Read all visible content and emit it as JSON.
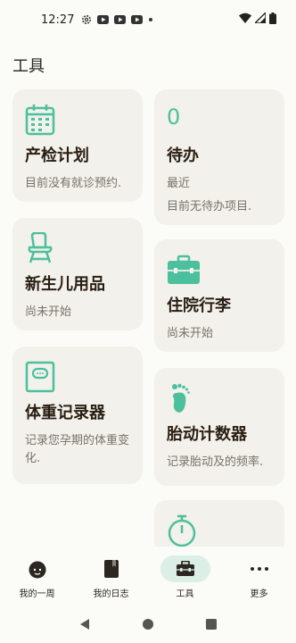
{
  "status_bar": {
    "time": "12:27",
    "icons": [
      "settings-icon",
      "youtube-icon",
      "youtube-icon",
      "youtube-icon",
      "dot-icon"
    ],
    "right_icons": [
      "wifi-icon",
      "signal-icon",
      "battery-icon"
    ]
  },
  "page": {
    "title": "工具"
  },
  "cards": {
    "plan": {
      "title": "产检计划",
      "subtitle": "目前没有就诊预约.",
      "icon": "calendar-icon"
    },
    "todo": {
      "count": "0",
      "title": "待办",
      "subtitle_1": "最近",
      "subtitle_2": "目前无待办项目."
    },
    "baby": {
      "title": "新生儿用品",
      "subtitle": "尚未开始",
      "icon": "baby-chair-icon"
    },
    "hospital": {
      "title": "住院行李",
      "subtitle": "尚未开始",
      "icon": "suitcase-icon"
    },
    "weight": {
      "title": "体重记录器",
      "subtitle": "记录您孕期的体重变化.",
      "icon": "scale-icon"
    },
    "kick": {
      "title": "胎动计数器",
      "subtitle": "记录胎动及的频率.",
      "icon": "footprint-icon"
    },
    "timer": {
      "icon": "stopwatch-icon"
    }
  },
  "nav": {
    "items": [
      {
        "label": "我的一周",
        "icon": "baby-face-icon"
      },
      {
        "label": "我的日志",
        "icon": "journal-icon"
      },
      {
        "label": "工具",
        "icon": "toolbox-icon",
        "active": true
      },
      {
        "label": "更多",
        "icon": "more-dots-icon"
      }
    ]
  },
  "colors": {
    "accent": "#4cc09d",
    "card_bg": "#f2f1eb",
    "active_pill": "#dcefe6"
  }
}
